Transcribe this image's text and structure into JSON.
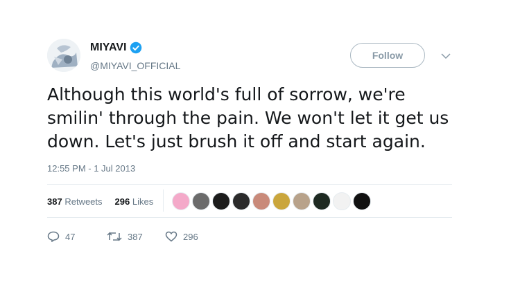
{
  "user": {
    "display_name": "MIYAVI",
    "handle": "@MIYAVI_OFFICIAL",
    "verified": true
  },
  "follow_button": {
    "label": "Follow"
  },
  "tweet": {
    "lines": [
      "Although this world's full of sorrow, we're",
      "smilin' through the pain. We won't let it get us",
      "down. Let's just brush it off and start again."
    ],
    "timestamp": "12:55 PM - 1 Jul 2013"
  },
  "stats": {
    "retweets_count": "387",
    "retweets_label": "Retweets",
    "likes_count": "296",
    "likes_label": "Likes"
  },
  "likers": [
    {
      "icon": "pink-bunny-avatar",
      "color": "#f4a9c9"
    },
    {
      "icon": "gray-portrait-avatar",
      "color": "#6b6b6b"
    },
    {
      "icon": "dark-circle-avatar",
      "color": "#1c1c1c"
    },
    {
      "icon": "dark-portrait-avatar",
      "color": "#2b2b2b"
    },
    {
      "icon": "face-portrait-avatar",
      "color": "#c98a7a"
    },
    {
      "icon": "gold-seal-avatar",
      "color": "#caa63c"
    },
    {
      "icon": "light-portrait-avatar",
      "color": "#b8a28a"
    },
    {
      "icon": "black-green-avatar",
      "color": "#1e2a22"
    },
    {
      "icon": "white-sketch-avatar",
      "color": "#f2f2f2"
    },
    {
      "icon": "black-white-avatar",
      "color": "#111111"
    }
  ],
  "actions": {
    "reply_count": "47",
    "retweet_count": "387",
    "like_count": "296"
  },
  "colors": {
    "verified_blue": "#1da1f2",
    "secondary_text": "#657786",
    "follow_border": "#aab8c2"
  }
}
